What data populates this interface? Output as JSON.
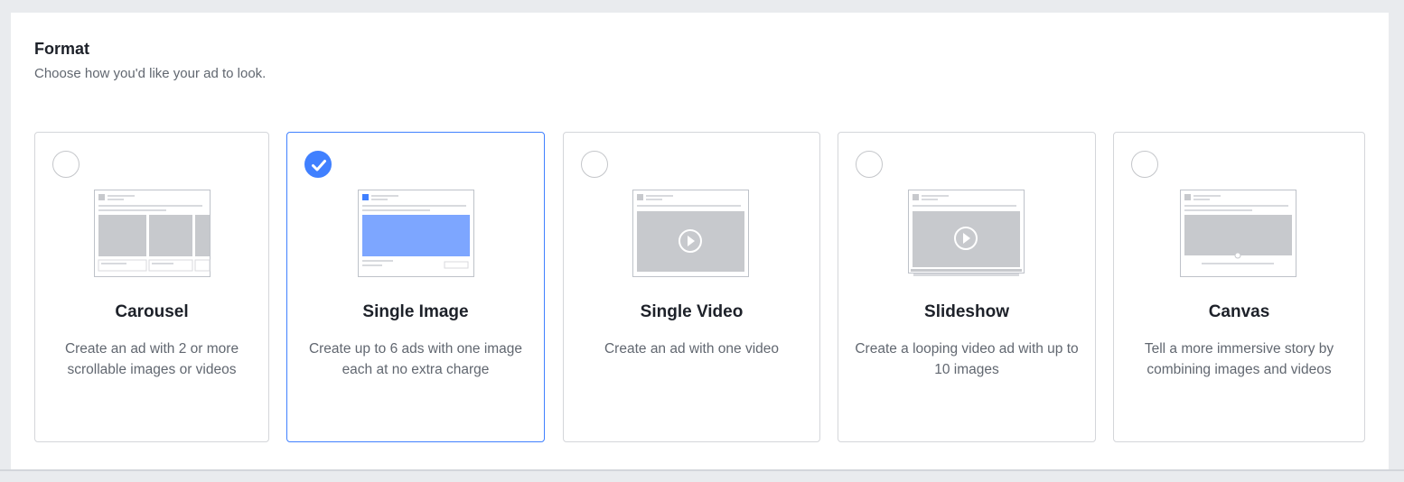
{
  "section": {
    "title": "Format",
    "subtitle": "Choose how you'd like your ad to look."
  },
  "formats": [
    {
      "key": "carousel",
      "title": "Carousel",
      "description": "Create an ad with 2 or more scrollable images or videos",
      "selected": false,
      "thumbnail_icon": "carousel-thumbnail-icon"
    },
    {
      "key": "single-image",
      "title": "Single Image",
      "description": "Create up to 6 ads with one image each at no extra charge",
      "selected": true,
      "thumbnail_icon": "single-image-thumbnail-icon"
    },
    {
      "key": "single-video",
      "title": "Single Video",
      "description": "Create an ad with one video",
      "selected": false,
      "thumbnail_icon": "single-video-thumbnail-icon"
    },
    {
      "key": "slideshow",
      "title": "Slideshow",
      "description": "Create a looping video ad with up to 10 images",
      "selected": false,
      "thumbnail_icon": "slideshow-thumbnail-icon"
    },
    {
      "key": "canvas",
      "title": "Canvas",
      "description": "Tell a more immersive story by combining images and videos",
      "selected": false,
      "thumbnail_icon": "canvas-thumbnail-icon"
    }
  ],
  "colors": {
    "accent": "#4080ff",
    "placeholder_gray": "#c7c9cd",
    "border": "#d4d6da",
    "title_text": "#1d2129",
    "body_text": "#616770"
  }
}
